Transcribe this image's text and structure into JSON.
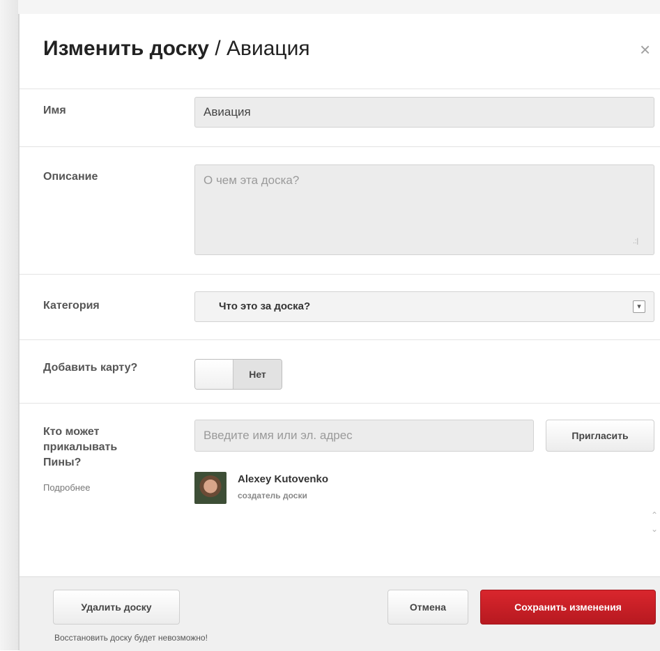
{
  "dialog": {
    "title_action": "Изменить доску",
    "title_separator": " / ",
    "title_board": "Авиация",
    "close_icon": "×"
  },
  "form": {
    "name": {
      "label": "Имя",
      "value": "Авиация"
    },
    "description": {
      "label": "Описание",
      "placeholder": "О чем эта доска?",
      "resize_icon": ".:|"
    },
    "category": {
      "label": "Категория",
      "selected": "Что это за доска?",
      "arrow_icon": "▾"
    },
    "map": {
      "label": "Добавить карту?",
      "toggle_value": "Нет"
    },
    "collaborators": {
      "label": "Кто может прикалывать Пины?",
      "more_link": "Подробнее",
      "placeholder": "Введите имя или эл. адрес",
      "invite_label": "Пригласить",
      "owner": {
        "name": "Alexey Kutovenko",
        "role": "создатель доски"
      }
    }
  },
  "footer": {
    "delete_label": "Удалить доску",
    "delete_warning": "Восстановить доску будет невозможно!",
    "cancel_label": "Отмена",
    "save_label": "Сохранить изменения"
  }
}
